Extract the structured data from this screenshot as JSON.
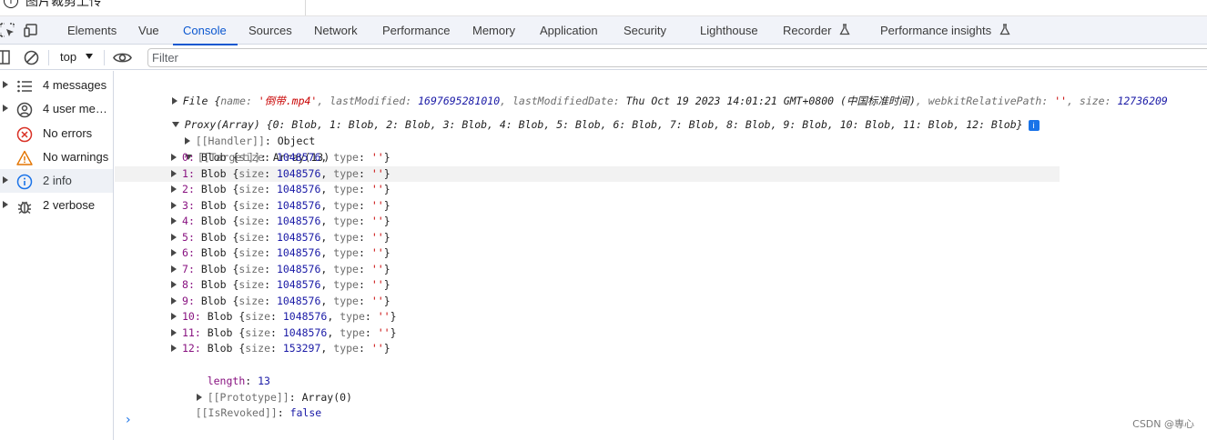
{
  "page_top": {
    "cut_text": "图片裁剪上传"
  },
  "tabs": [
    {
      "label": "Elements"
    },
    {
      "label": "Vue"
    },
    {
      "label": "Console"
    },
    {
      "label": "Sources"
    },
    {
      "label": "Network"
    },
    {
      "label": "Performance"
    },
    {
      "label": "Memory"
    },
    {
      "label": "Application"
    },
    {
      "label": "Security"
    },
    {
      "label": "Lighthouse"
    },
    {
      "label": "Recorder"
    },
    {
      "label": "Performance insights"
    }
  ],
  "active_tab": "Console",
  "toolbar": {
    "context": "top",
    "filter_placeholder": "Filter"
  },
  "sidebar": {
    "items": [
      {
        "label": "4 messages",
        "icon": "list-icon"
      },
      {
        "label": "4 user mes…",
        "icon": "user-icon"
      },
      {
        "label": "No errors",
        "icon": "error-icon"
      },
      {
        "label": "No warnings",
        "icon": "warning-icon"
      },
      {
        "label": "2 info",
        "icon": "info-icon"
      },
      {
        "label": "2 verbose",
        "icon": "bug-icon"
      }
    ],
    "selected": "2 info"
  },
  "console": {
    "file_line": {
      "prefix": "File {",
      "name_key": "name: ",
      "name_val": "'倒带.mp4'",
      "lm_key": ", lastModified: ",
      "lm_val": "1697695281010",
      "lmd_key": ", lastModifiedDate: ",
      "lmd_val": "Thu Oct 19 2023 14:01:21 GMT+0800 (中国标准时间)",
      "wrp_key": ", webkitRelativePath: ",
      "wrp_val": "''",
      "size_key": ", size: ",
      "size_val": "12736209"
    },
    "proxy_line": "Proxy(Array) {0: Blob, 1: Blob, 2: Blob, 3: Blob, 4: Blob, 5: Blob, 6: Blob, 7: Blob, 8: Blob, 9: Blob, 10: Blob, 11: Blob, 12: Blob}",
    "info_badge": "i",
    "handler": {
      "key": "[[Handler]]",
      "val": "Object"
    },
    "target": {
      "key": "[[Target]]",
      "val": "Array(13)"
    },
    "blobs": [
      {
        "index": "0",
        "size": "1048576",
        "type": "''"
      },
      {
        "index": "1",
        "size": "1048576",
        "type": "''"
      },
      {
        "index": "2",
        "size": "1048576",
        "type": "''"
      },
      {
        "index": "3",
        "size": "1048576",
        "type": "''"
      },
      {
        "index": "4",
        "size": "1048576",
        "type": "''"
      },
      {
        "index": "5",
        "size": "1048576",
        "type": "''"
      },
      {
        "index": "6",
        "size": "1048576",
        "type": "''"
      },
      {
        "index": "7",
        "size": "1048576",
        "type": "''"
      },
      {
        "index": "8",
        "size": "1048576",
        "type": "''"
      },
      {
        "index": "9",
        "size": "1048576",
        "type": "''"
      },
      {
        "index": "10",
        "size": "1048576",
        "type": "''"
      },
      {
        "index": "11",
        "size": "1048576",
        "type": "''"
      },
      {
        "index": "12",
        "size": "153297",
        "type": "''"
      }
    ],
    "highlighted_row": "1",
    "length": {
      "key": "length",
      "val": "13"
    },
    "prototype": {
      "key": "[[Prototype]]",
      "val": "Array(0)"
    },
    "revoked": {
      "key": "[[IsRevoked]]",
      "val": "false"
    }
  },
  "watermark": "CSDN @専心",
  "colors": {
    "accent": "#0b57d0",
    "key": "#881280",
    "string": "#c80000",
    "number": "#1a1aa6"
  }
}
